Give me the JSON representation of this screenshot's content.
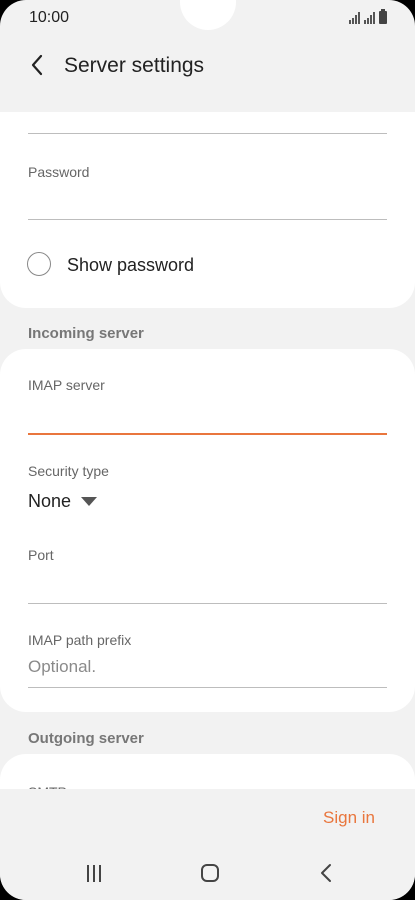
{
  "status_bar": {
    "time": "10:00"
  },
  "header": {
    "title": "Server settings"
  },
  "account_section": {
    "password": {
      "label": "Password",
      "value": ""
    },
    "show_password": {
      "label": "Show password",
      "checked": false
    }
  },
  "incoming": {
    "section_label": "Incoming server",
    "imap_server": {
      "label": "IMAP server",
      "value": ""
    },
    "security_type": {
      "label": "Security type",
      "value": "None"
    },
    "port": {
      "label": "Port",
      "value": ""
    },
    "imap_path_prefix": {
      "label": "IMAP path prefix",
      "placeholder": "Optional."
    }
  },
  "outgoing": {
    "section_label": "Outgoing server",
    "smtp_label": "SMTP"
  },
  "actions": {
    "sign_in": "Sign in"
  },
  "colors": {
    "accent": "#e9763d",
    "background": "#f2f2f2",
    "card": "#ffffff"
  }
}
